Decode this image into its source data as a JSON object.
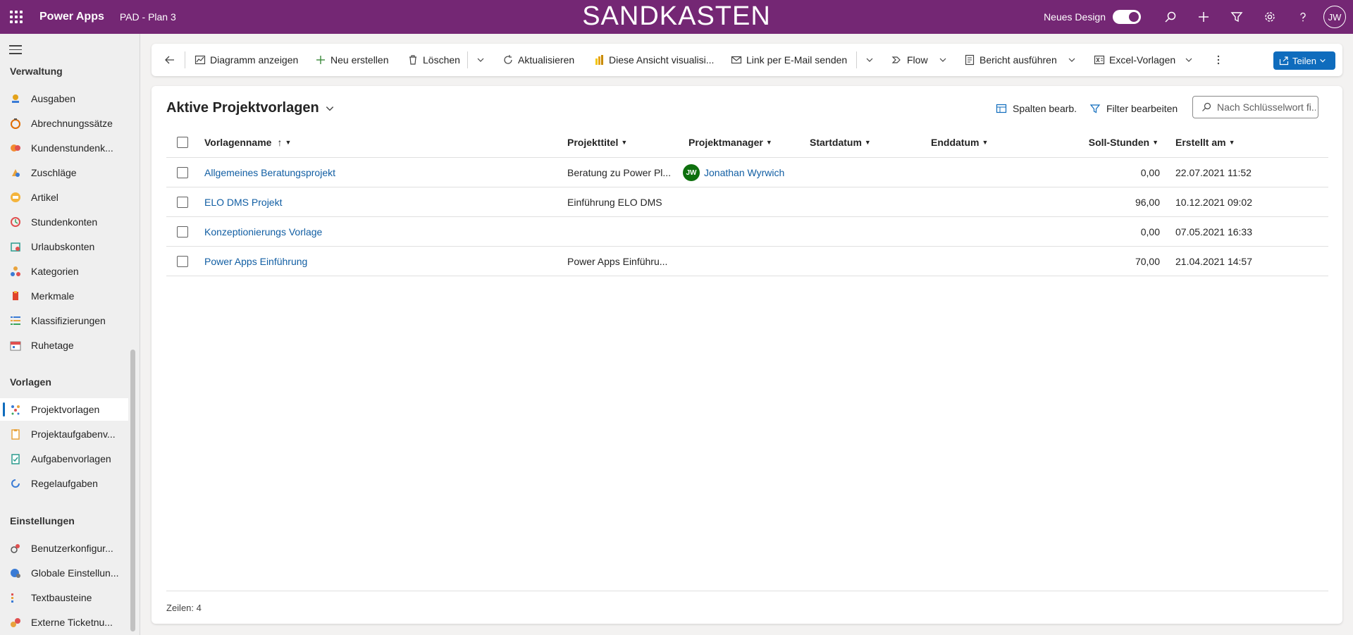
{
  "topbar": {
    "app_name": "Power Apps",
    "environment": "PAD - Plan 3",
    "banner": "SANDKASTEN",
    "new_design_label": "Neues Design",
    "new_design_enabled": true,
    "user_initials": "JW"
  },
  "sidebar": {
    "sections": [
      {
        "label": "Verwaltung",
        "items": [
          {
            "label": "Ausgaben",
            "icon": "expenses-icon"
          },
          {
            "label": "Abrechnungssätze",
            "icon": "rates-icon"
          },
          {
            "label": "Kundenstundenk...",
            "icon": "customer-hours-icon"
          },
          {
            "label": "Zuschläge",
            "icon": "surcharge-icon"
          },
          {
            "label": "Artikel",
            "icon": "article-icon"
          },
          {
            "label": "Stundenkonten",
            "icon": "hour-accounts-icon"
          },
          {
            "label": "Urlaubskonten",
            "icon": "vacation-icon"
          },
          {
            "label": "Kategorien",
            "icon": "categories-icon"
          },
          {
            "label": "Merkmale",
            "icon": "features-icon"
          },
          {
            "label": "Klassifizierungen",
            "icon": "classifications-icon"
          },
          {
            "label": "Ruhetage",
            "icon": "rest-days-icon"
          }
        ]
      },
      {
        "label": "Vorlagen",
        "items": [
          {
            "label": "Projektvorlagen",
            "icon": "project-templates-icon",
            "active": true
          },
          {
            "label": "Projektaufgabenv...",
            "icon": "project-task-templates-icon"
          },
          {
            "label": "Aufgabenvorlagen",
            "icon": "task-templates-icon"
          },
          {
            "label": "Regelaufgaben",
            "icon": "recurring-tasks-icon"
          }
        ]
      },
      {
        "label": "Einstellungen",
        "items": [
          {
            "label": "Benutzerkonfigur...",
            "icon": "user-config-icon"
          },
          {
            "label": "Globale Einstellun...",
            "icon": "global-settings-icon"
          },
          {
            "label": "Textbausteine",
            "icon": "text-blocks-icon"
          },
          {
            "label": "Externe Ticketnu...",
            "icon": "external-tickets-icon"
          }
        ]
      }
    ]
  },
  "commandbar": {
    "show_chart": "Diagramm anzeigen",
    "new": "Neu erstellen",
    "delete": "Löschen",
    "refresh": "Aktualisieren",
    "visualize": "Diese Ansicht visualisi...",
    "email_link": "Link per E-Mail senden",
    "flow": "Flow",
    "run_report": "Bericht ausführen",
    "excel_templates": "Excel-Vorlagen",
    "share": "Teilen"
  },
  "view": {
    "title": "Aktive Projektvorlagen",
    "edit_columns": "Spalten bearb.",
    "edit_filters": "Filter bearbeiten",
    "search_placeholder": "Nach Schlüsselwort fi...",
    "columns": [
      "Vorlagenname",
      "Projekttitel",
      "Projektmanager",
      "Startdatum",
      "Enddatum",
      "Soll-Stunden",
      "Erstellt am"
    ],
    "sort_indicator": "↑",
    "rows": [
      {
        "name": "Allgemeines Beratungsprojekt",
        "title": "Beratung zu Power Pl...",
        "manager": "Jonathan Wyrwich",
        "manager_initials": "JW",
        "start": "",
        "end": "",
        "hours": "0,00",
        "created": "22.07.2021 11:52"
      },
      {
        "name": "ELO DMS Projekt",
        "title": "Einführung ELO DMS",
        "manager": "",
        "manager_initials": "",
        "start": "",
        "end": "",
        "hours": "96,00",
        "created": "10.12.2021 09:02"
      },
      {
        "name": "Konzeptionierungs Vorlage",
        "title": "",
        "manager": "",
        "manager_initials": "",
        "start": "",
        "end": "",
        "hours": "0,00",
        "created": "07.05.2021 16:33"
      },
      {
        "name": "Power Apps Einführung",
        "title": "Power Apps Einführu...",
        "manager": "",
        "manager_initials": "",
        "start": "",
        "end": "",
        "hours": "70,00",
        "created": "21.04.2021 14:57"
      }
    ],
    "footer": "Zeilen: 4"
  },
  "colors": {
    "header_bg": "#742774",
    "accent": "#0f6cbd",
    "link": "#115ea3",
    "avatar_green": "#0e700e"
  }
}
